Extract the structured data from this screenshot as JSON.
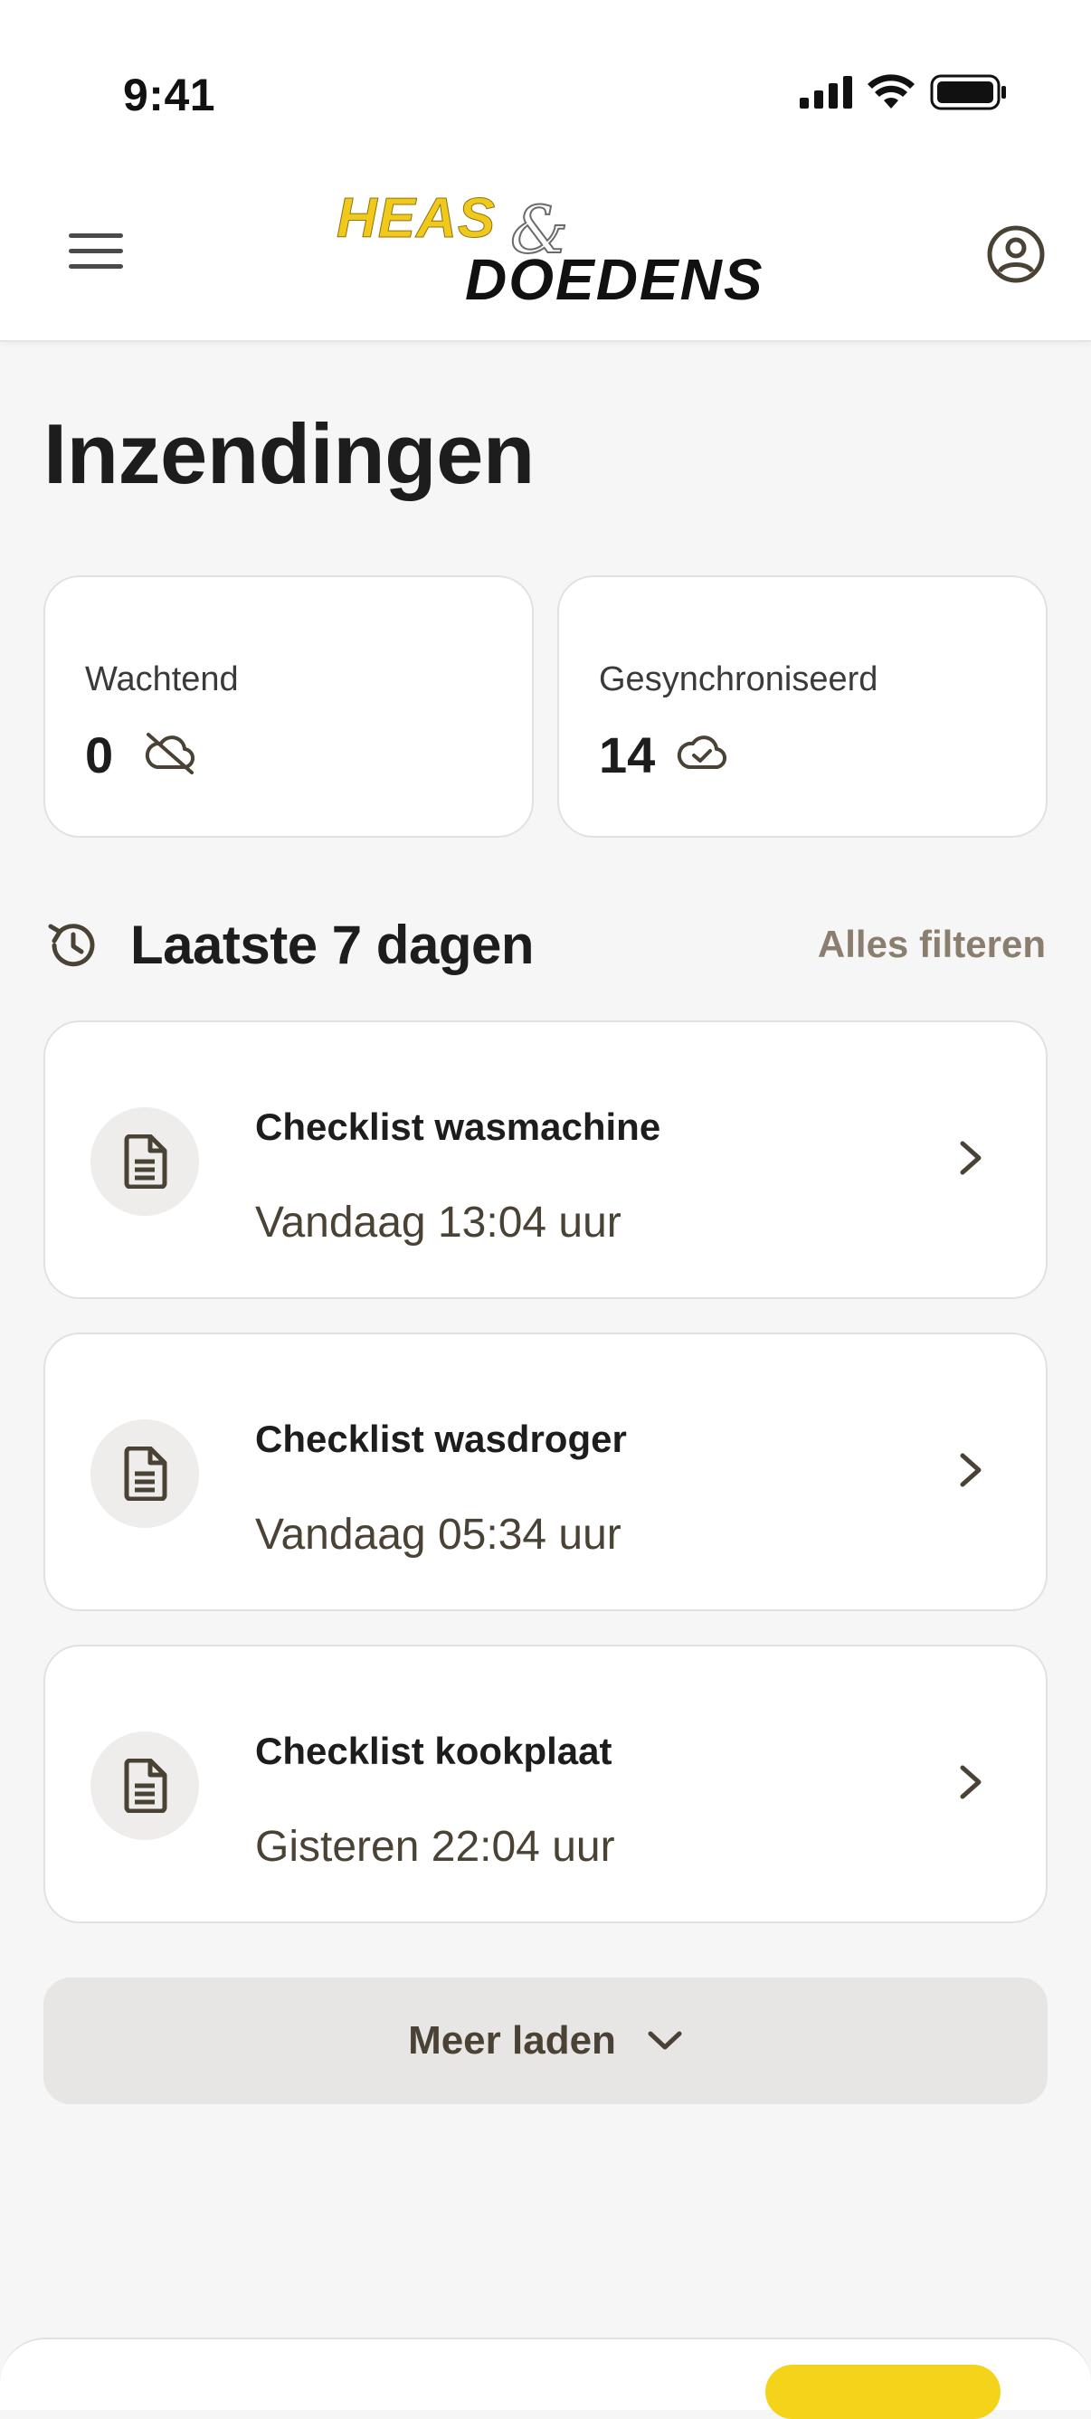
{
  "status_bar": {
    "time": "9:41"
  },
  "brand": {
    "part1": "HEAS",
    "amp": "&",
    "part2": "DOEDENS"
  },
  "page": {
    "title": "Inzendingen"
  },
  "stats": {
    "pending": {
      "label": "Wachtend",
      "value": "0",
      "icon": "cloud-off-icon"
    },
    "synced": {
      "label": "Gesynchroniseerd",
      "value": "14",
      "icon": "cloud-check-icon"
    }
  },
  "section": {
    "title": "Laatste 7 dagen",
    "filter_label": "Alles filteren",
    "icon": "history-icon"
  },
  "submissions": [
    {
      "title": "Checklist wasmachine",
      "subtitle": "Vandaag 13:04 uur"
    },
    {
      "title": "Checklist wasdroger",
      "subtitle": "Vandaag 05:34 uur"
    },
    {
      "title": "Checklist kookplaat",
      "subtitle": "Gisteren 22:04 uur"
    }
  ],
  "load_more": {
    "label": "Meer laden"
  },
  "colors": {
    "brand_yellow": "#f1c91a",
    "accent_text": "#8a7f6e",
    "background": "#f7f6f6",
    "card": "#ffffff"
  }
}
